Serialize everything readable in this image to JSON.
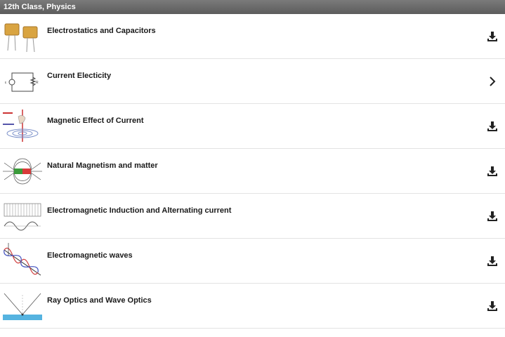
{
  "header": {
    "title": "12th Class, Physics"
  },
  "chapters": [
    {
      "label": "Electrostatics and Capacitors",
      "action_icon": "download-icon"
    },
    {
      "label": "Current Electicity",
      "action_icon": "chevron-right-icon"
    },
    {
      "label": "Magnetic Effect of Current",
      "action_icon": "download-icon"
    },
    {
      "label": "Natural Magnetism and matter",
      "action_icon": "download-icon"
    },
    {
      "label": "Electromagnetic Induction and Alternating current",
      "action_icon": "download-icon"
    },
    {
      "label": "Electromagnetic waves",
      "action_icon": "download-icon"
    },
    {
      "label": "Ray Optics and Wave Optics",
      "action_icon": "download-icon"
    }
  ],
  "colors": {
    "header_bg": "#666666",
    "divider": "#e3e3e3",
    "text": "#1a1a1a",
    "icon": "#222222"
  }
}
